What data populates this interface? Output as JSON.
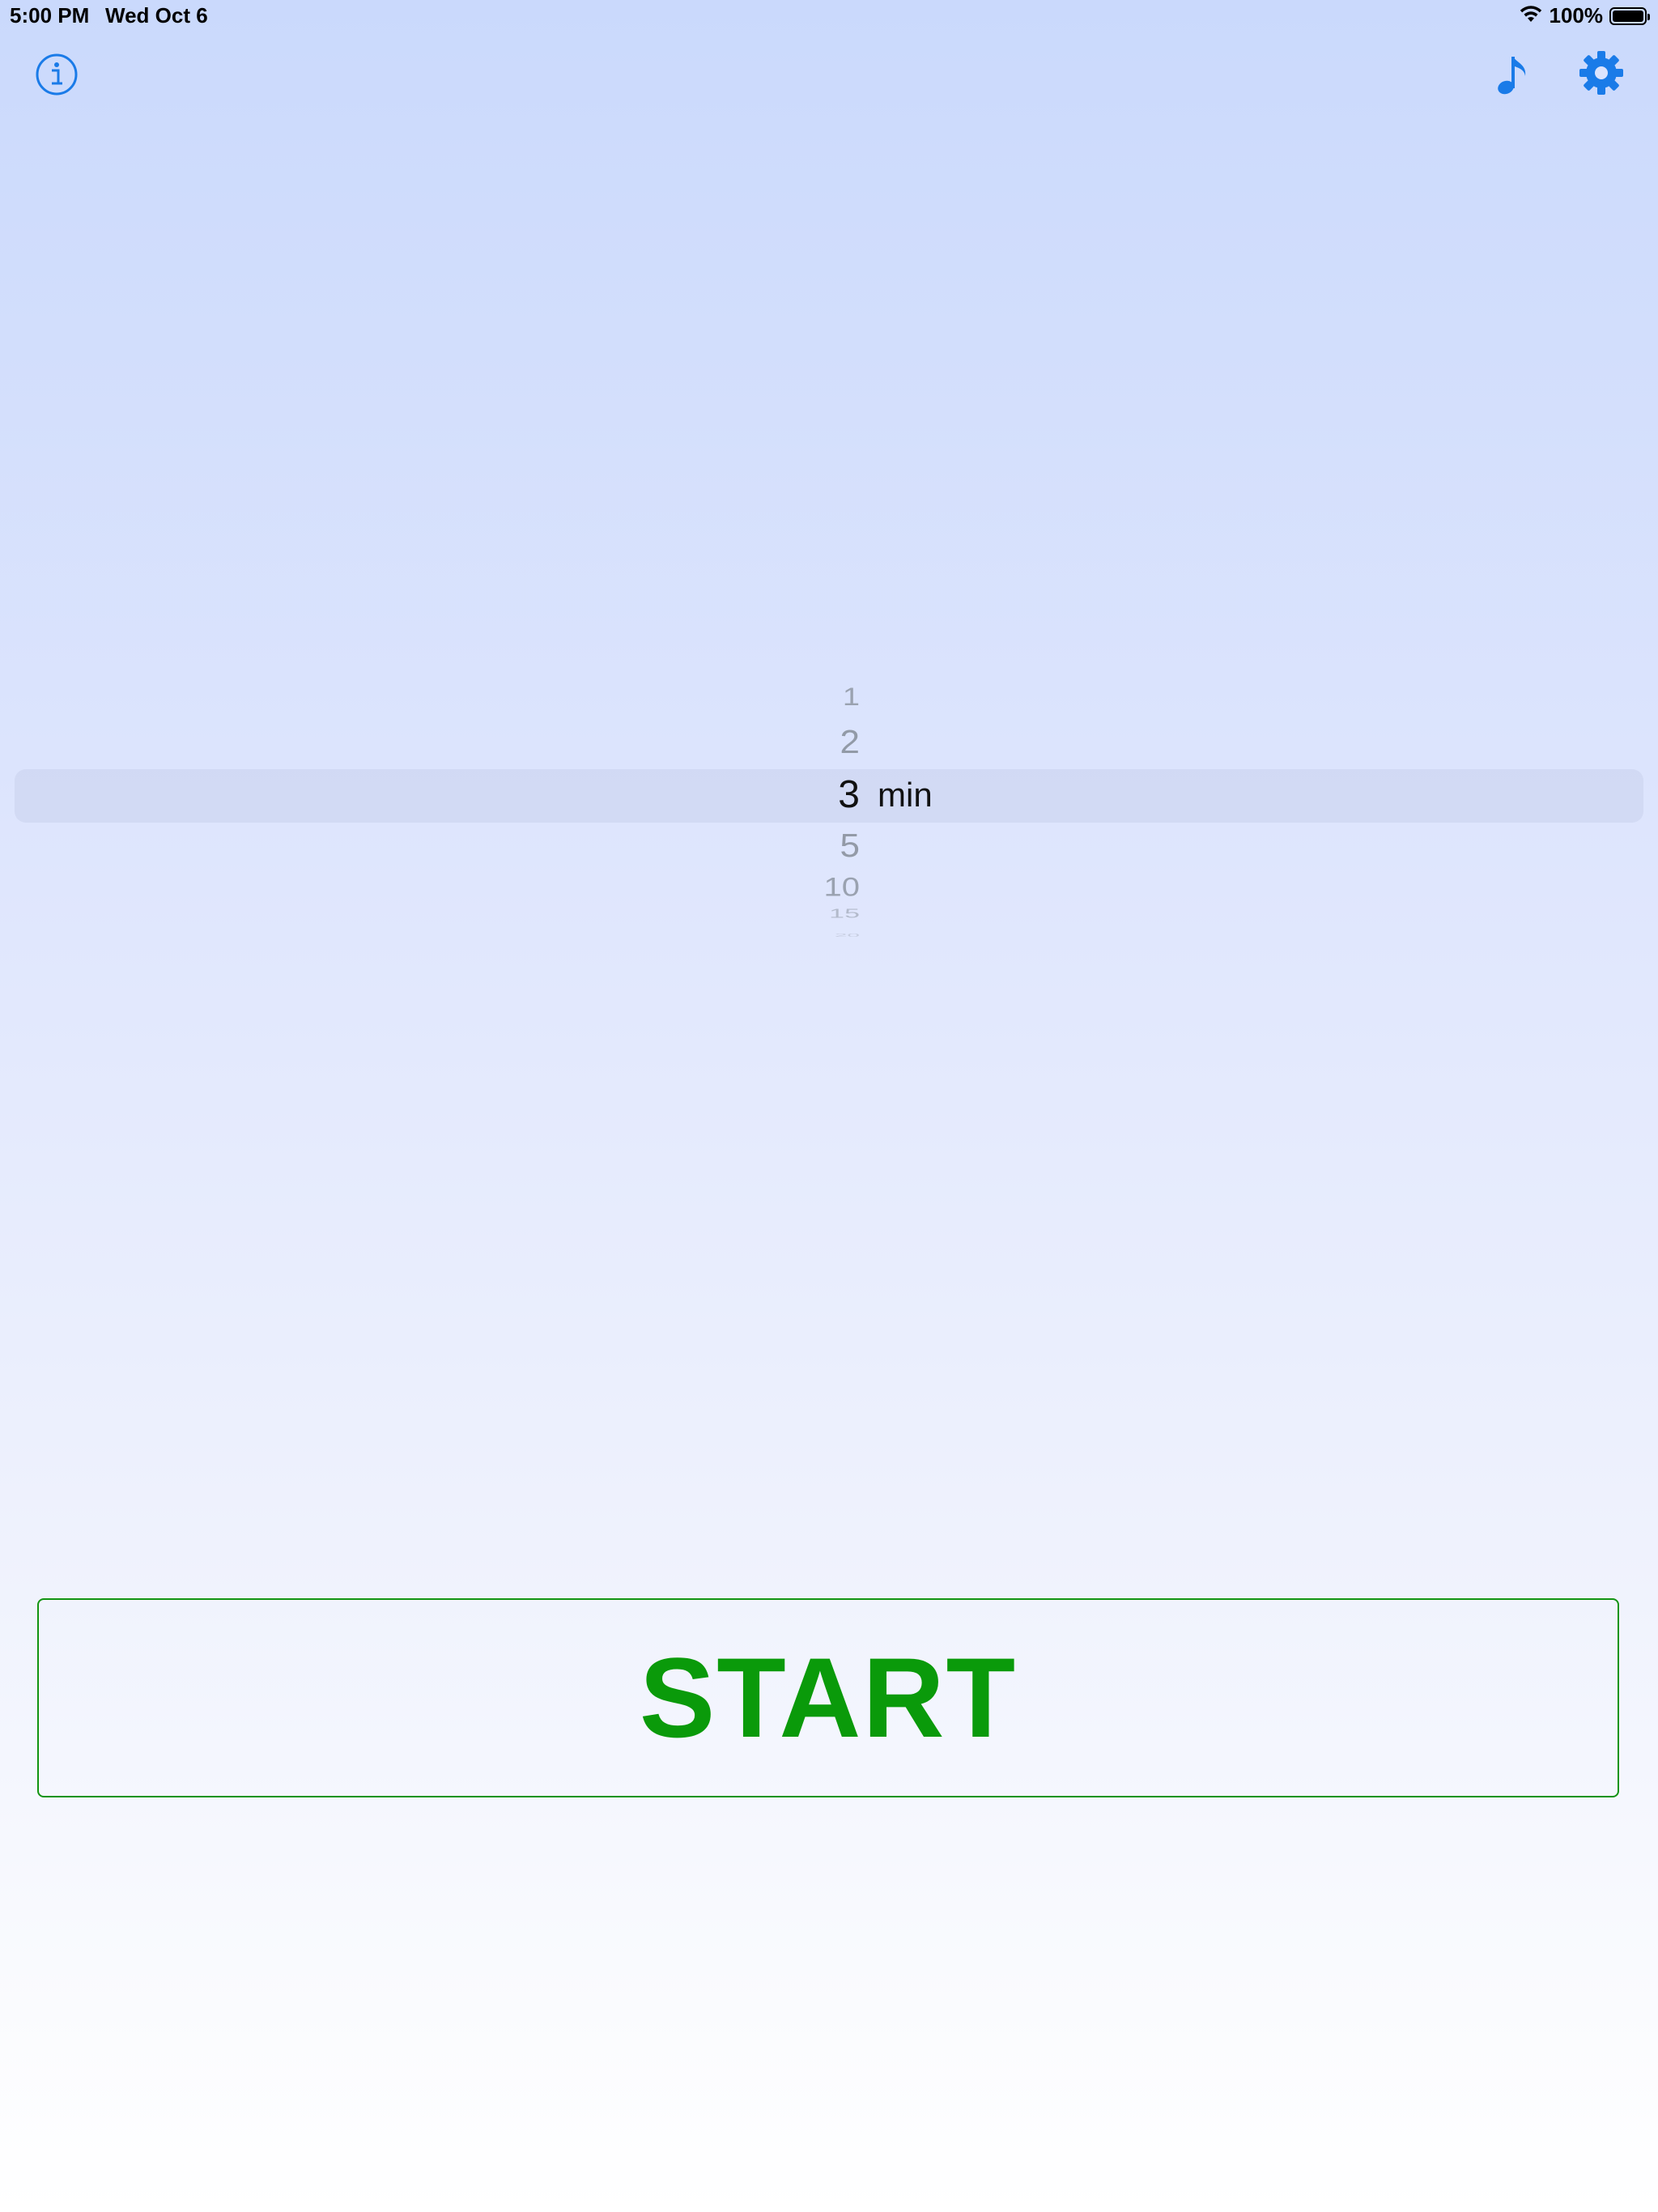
{
  "status_bar": {
    "time": "5:00 PM",
    "date": "Wed Oct 6",
    "battery_text": "100%",
    "battery_level": 1.0
  },
  "toolbar": {
    "info_icon": "info-circle-icon",
    "music_icon": "music-note-icon",
    "settings_icon": "gear-icon",
    "accent_color": "#1a7be8"
  },
  "picker": {
    "items": [
      "1",
      "2",
      "3",
      "5",
      "10",
      "15",
      "20"
    ],
    "selected_value": "3",
    "unit_label": "min"
  },
  "start_button": {
    "label": "START",
    "color": "#0a9a0a",
    "border_color": "#129412"
  }
}
